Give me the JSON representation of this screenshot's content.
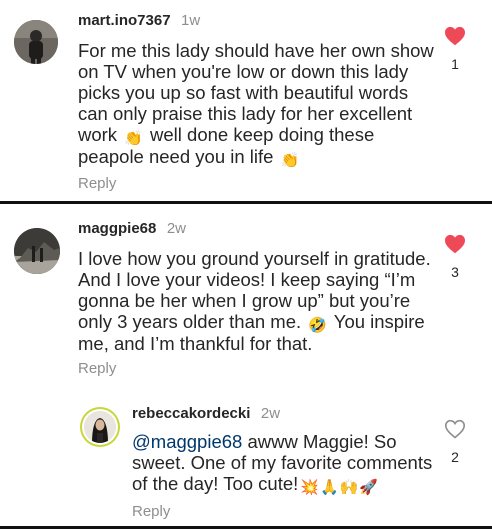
{
  "comments": [
    {
      "username": "mart.ino7367",
      "age": "1w",
      "text": "For me this lady should have her own show on TV when you're low or down this lady picks you up so fast with beautiful words can only praise this lady for her excellent work 👏 well done keep doing these peapole need you in life 👏",
      "lines": [
        "For me this lady should have her own show",
        "on TV when you're low or down this lady",
        "picks you up so fast with beautiful words",
        "can only praise this lady for her excellent",
        "work",
        "well done keep doing these",
        "peapole need you in life"
      ],
      "emoji_clap": "👏",
      "like_count": "1",
      "reply_label": "Reply",
      "liked": true
    },
    {
      "username": "maggpie68",
      "age": "2w",
      "text": "I love how you ground yourself in gratitude. And I love your videos! I keep saying “I’m gonna be her when I grow up” but you’re only 3 years older than me. 🤣 You inspire me, and I’m thankful for that.",
      "lines": [
        "I love how you ground yourself in gratitude.",
        "And I love your videos! I keep saying “I’m",
        "gonna be her when I grow up” but you’re",
        "only 3 years older than me.",
        "You inspire",
        "me, and I’m thankful for that."
      ],
      "emoji_laugh": "🤣",
      "like_count": "3",
      "reply_label": "Reply",
      "liked": true
    },
    {
      "username": "rebeccakordecki",
      "age": "2w",
      "text": "@maggpie68 awww Maggie! So sweet. One of my favorite comments of the day! Too cute!💥🙏🏼🙌🏻🚀",
      "mention": "@maggpie68",
      "lines": [
        "awww Maggie! So",
        "sweet. One of my favorite comments",
        "of the day! Too cute!"
      ],
      "emojis_end": "💥🙏🙌🚀",
      "like_count": "2",
      "reply_label": "Reply",
      "liked": false
    }
  ],
  "colors": {
    "heart_red": "#ed4956",
    "meta_gray": "#8e8e8e",
    "mention_blue": "#00376b",
    "story_ring": "#c9d63a"
  },
  "icons": {
    "liked": "heart-filled-icon",
    "not_liked": "heart-outline-icon"
  }
}
